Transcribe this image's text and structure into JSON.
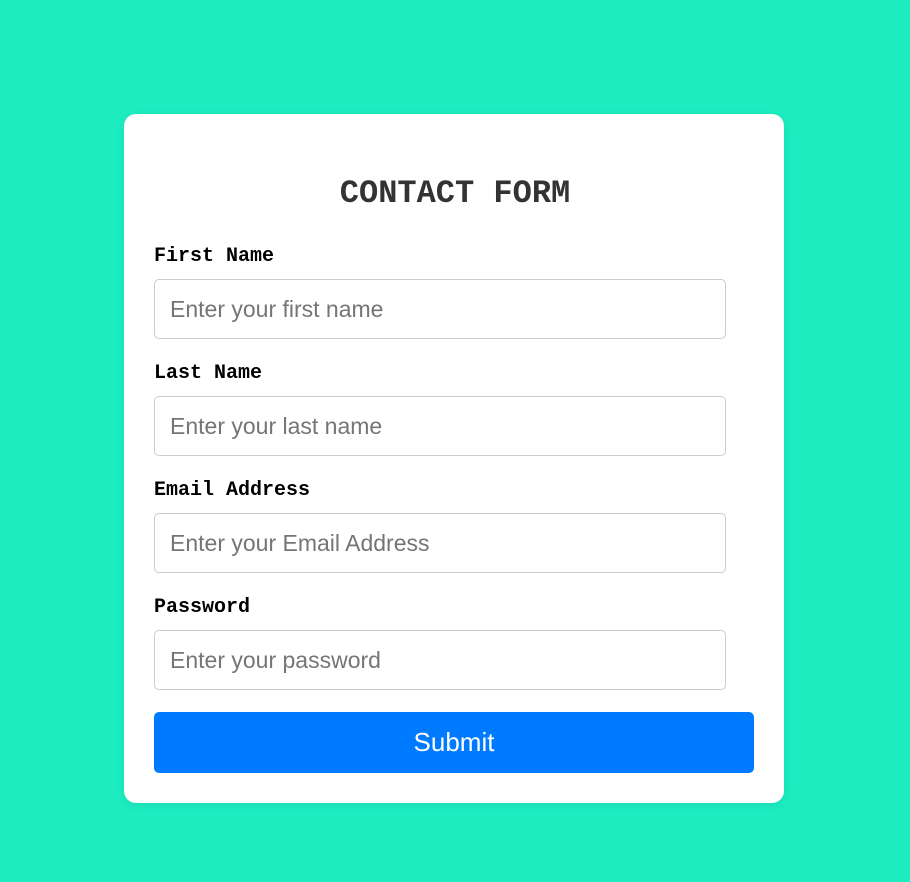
{
  "form": {
    "title": "CONTACT FORM",
    "fields": [
      {
        "label": "First Name",
        "placeholder": "Enter your first name",
        "value": ""
      },
      {
        "label": "Last Name",
        "placeholder": "Enter your last name",
        "value": ""
      },
      {
        "label": "Email Address",
        "placeholder": "Enter your Email Address",
        "value": ""
      },
      {
        "label": "Password",
        "placeholder": "Enter your password",
        "value": ""
      }
    ],
    "submit_label": "Submit"
  },
  "colors": {
    "background": "#1decc1",
    "card": "#ffffff",
    "button": "#007bff",
    "button_text": "#ffffff",
    "title": "#333333",
    "label": "#000000",
    "input_border": "#cccccc",
    "placeholder": "#757575"
  }
}
